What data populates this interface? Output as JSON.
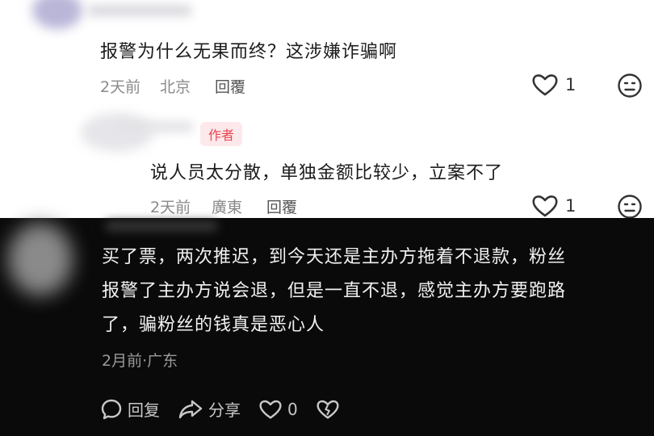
{
  "comments_light": [
    {
      "text": "报警为什么无果而终？这涉嫌诈骗啊",
      "time": "2天前",
      "location": "北京",
      "reply_label": "回覆",
      "likes": "1"
    },
    {
      "badge": "作者",
      "text": "说人员太分散，单独金额比较少，立案不了",
      "time": "2天前",
      "location": "廣東",
      "reply_label": "回覆",
      "likes": "1"
    }
  ],
  "comment_dark": {
    "lines": [
      "买了票，两次推迟，到今天还是主办方拖着不退款，粉丝",
      "报警了主办方说会退，但是一直不退，感觉主办方要跑路",
      "了，骗粉丝的钱真是恶心人"
    ],
    "meta": "2月前·广东",
    "reply_label": "回复",
    "share_label": "分享",
    "likes": "0"
  },
  "colors": {
    "light_bg": "#ffffff",
    "dark_bg": "#0a0a0a",
    "badge_bg": "#fde9ec",
    "badge_text": "#e8464f"
  },
  "icons": [
    "heart-outline-icon",
    "neutral-face-emoji-icon",
    "comment-bubble-icon",
    "share-arrow-icon",
    "broken-heart-icon"
  ]
}
